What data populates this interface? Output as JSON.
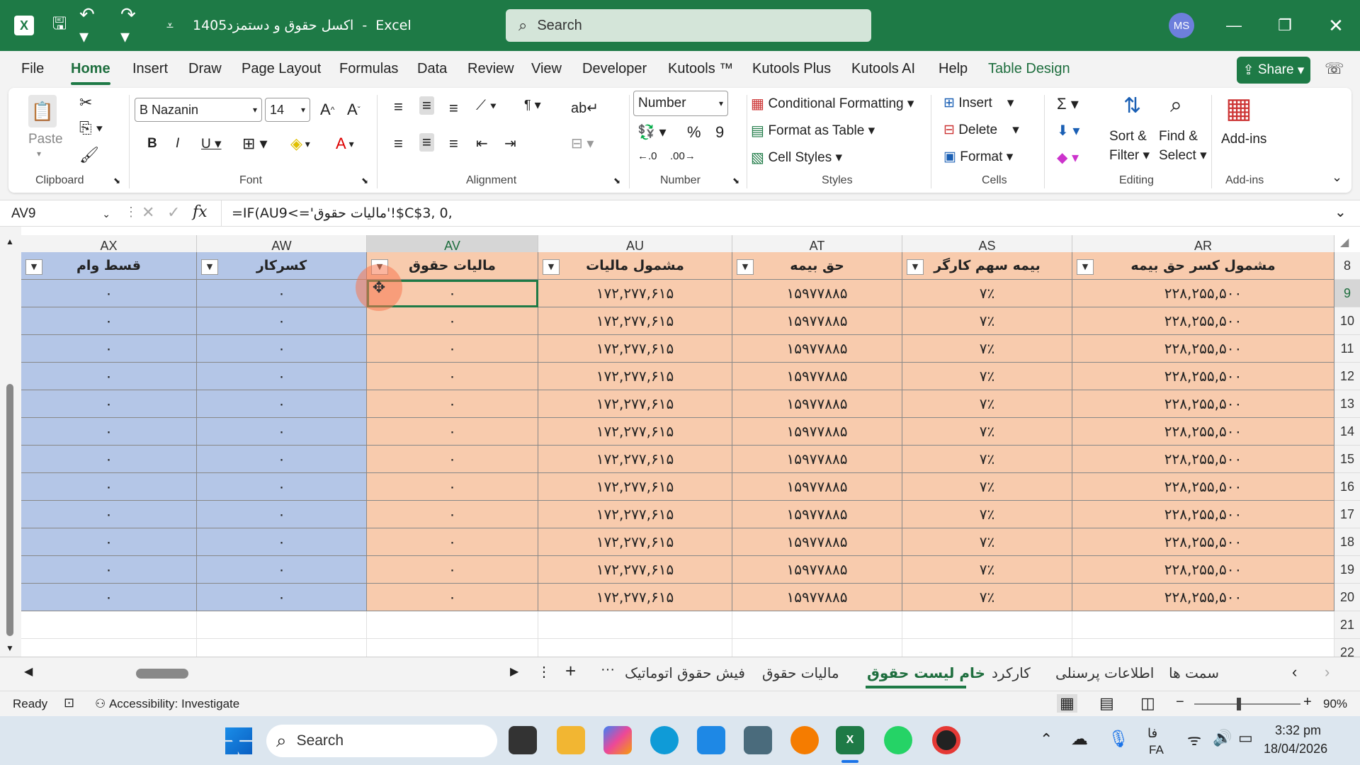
{
  "titlebar": {
    "filename": "اکسل حقوق و دستمزد1405",
    "app": "Excel",
    "search": "Search",
    "user_initials": "MS"
  },
  "tabs": [
    "File",
    "Home",
    "Insert",
    "Draw",
    "Page Layout",
    "Formulas",
    "Data",
    "Review",
    "View",
    "Developer",
    "Kutools ™",
    "Kutools Plus",
    "Kutools AI",
    "Help",
    "Table Design"
  ],
  "share_label": "Share",
  "ribbon": {
    "paste": "Paste",
    "font_name": "B Nazanin",
    "font_size": "14",
    "number_format": "Number",
    "conditional": "Conditional Formatting",
    "format_table": "Format as Table",
    "cell_styles": "Cell Styles",
    "insert": "Insert",
    "delete": "Delete",
    "format": "Format",
    "sort": "Sort &",
    "filter": "Filter",
    "find": "Find &",
    "select": "Select",
    "addins": "Add-ins",
    "groups": {
      "clipboard": "Clipboard",
      "font": "Font",
      "alignment": "Alignment",
      "number": "Number",
      "styles": "Styles",
      "cells": "Cells",
      "editing": "Editing",
      "addins": "Add-ins"
    }
  },
  "formula_bar": {
    "name_box": "AV9",
    "formula": "=IF(AU9<='مالیات حقوق'!$C$3, 0,"
  },
  "columns": [
    "AX",
    "AW",
    "AV",
    "AU",
    "AT",
    "AS",
    "AR"
  ],
  "headers": [
    "قسط وام",
    "کسرکار",
    "مالیات حقوق",
    "مشمول مالیات",
    "حق بیمه",
    "بیمه سهم کارگر",
    "مشمول کسر حق بیمه"
  ],
  "row_numbers": [
    "8",
    "9",
    "10",
    "11",
    "12",
    "13",
    "14",
    "15",
    "16",
    "17",
    "18",
    "19",
    "20",
    "21",
    "22"
  ],
  "row_values": [
    "۰",
    "۰",
    "۰",
    "۱۷۲,۲۷۷,۶۱۵",
    "۱۵۹۷۷۸۸۵",
    "۷٪",
    "۲۲۸,۲۵۵,۵۰۰"
  ],
  "data_row_count": 12,
  "sheet_tabs": [
    "فیش حقوق اتوماتیک",
    "مالیات حقوق",
    "خام لیست حقوق",
    "کارکرد",
    "اطلاعات پرسنلی",
    "سمت ها"
  ],
  "active_sheet": "خام لیست حقوق",
  "status": {
    "ready": "Ready",
    "accessibility": "Accessibility: Investigate",
    "zoom": "90%"
  },
  "taskbar": {
    "search": "Search",
    "lang_top": "فا",
    "lang": "FA",
    "time": "3:32 pm",
    "date": "18/04/2026"
  }
}
